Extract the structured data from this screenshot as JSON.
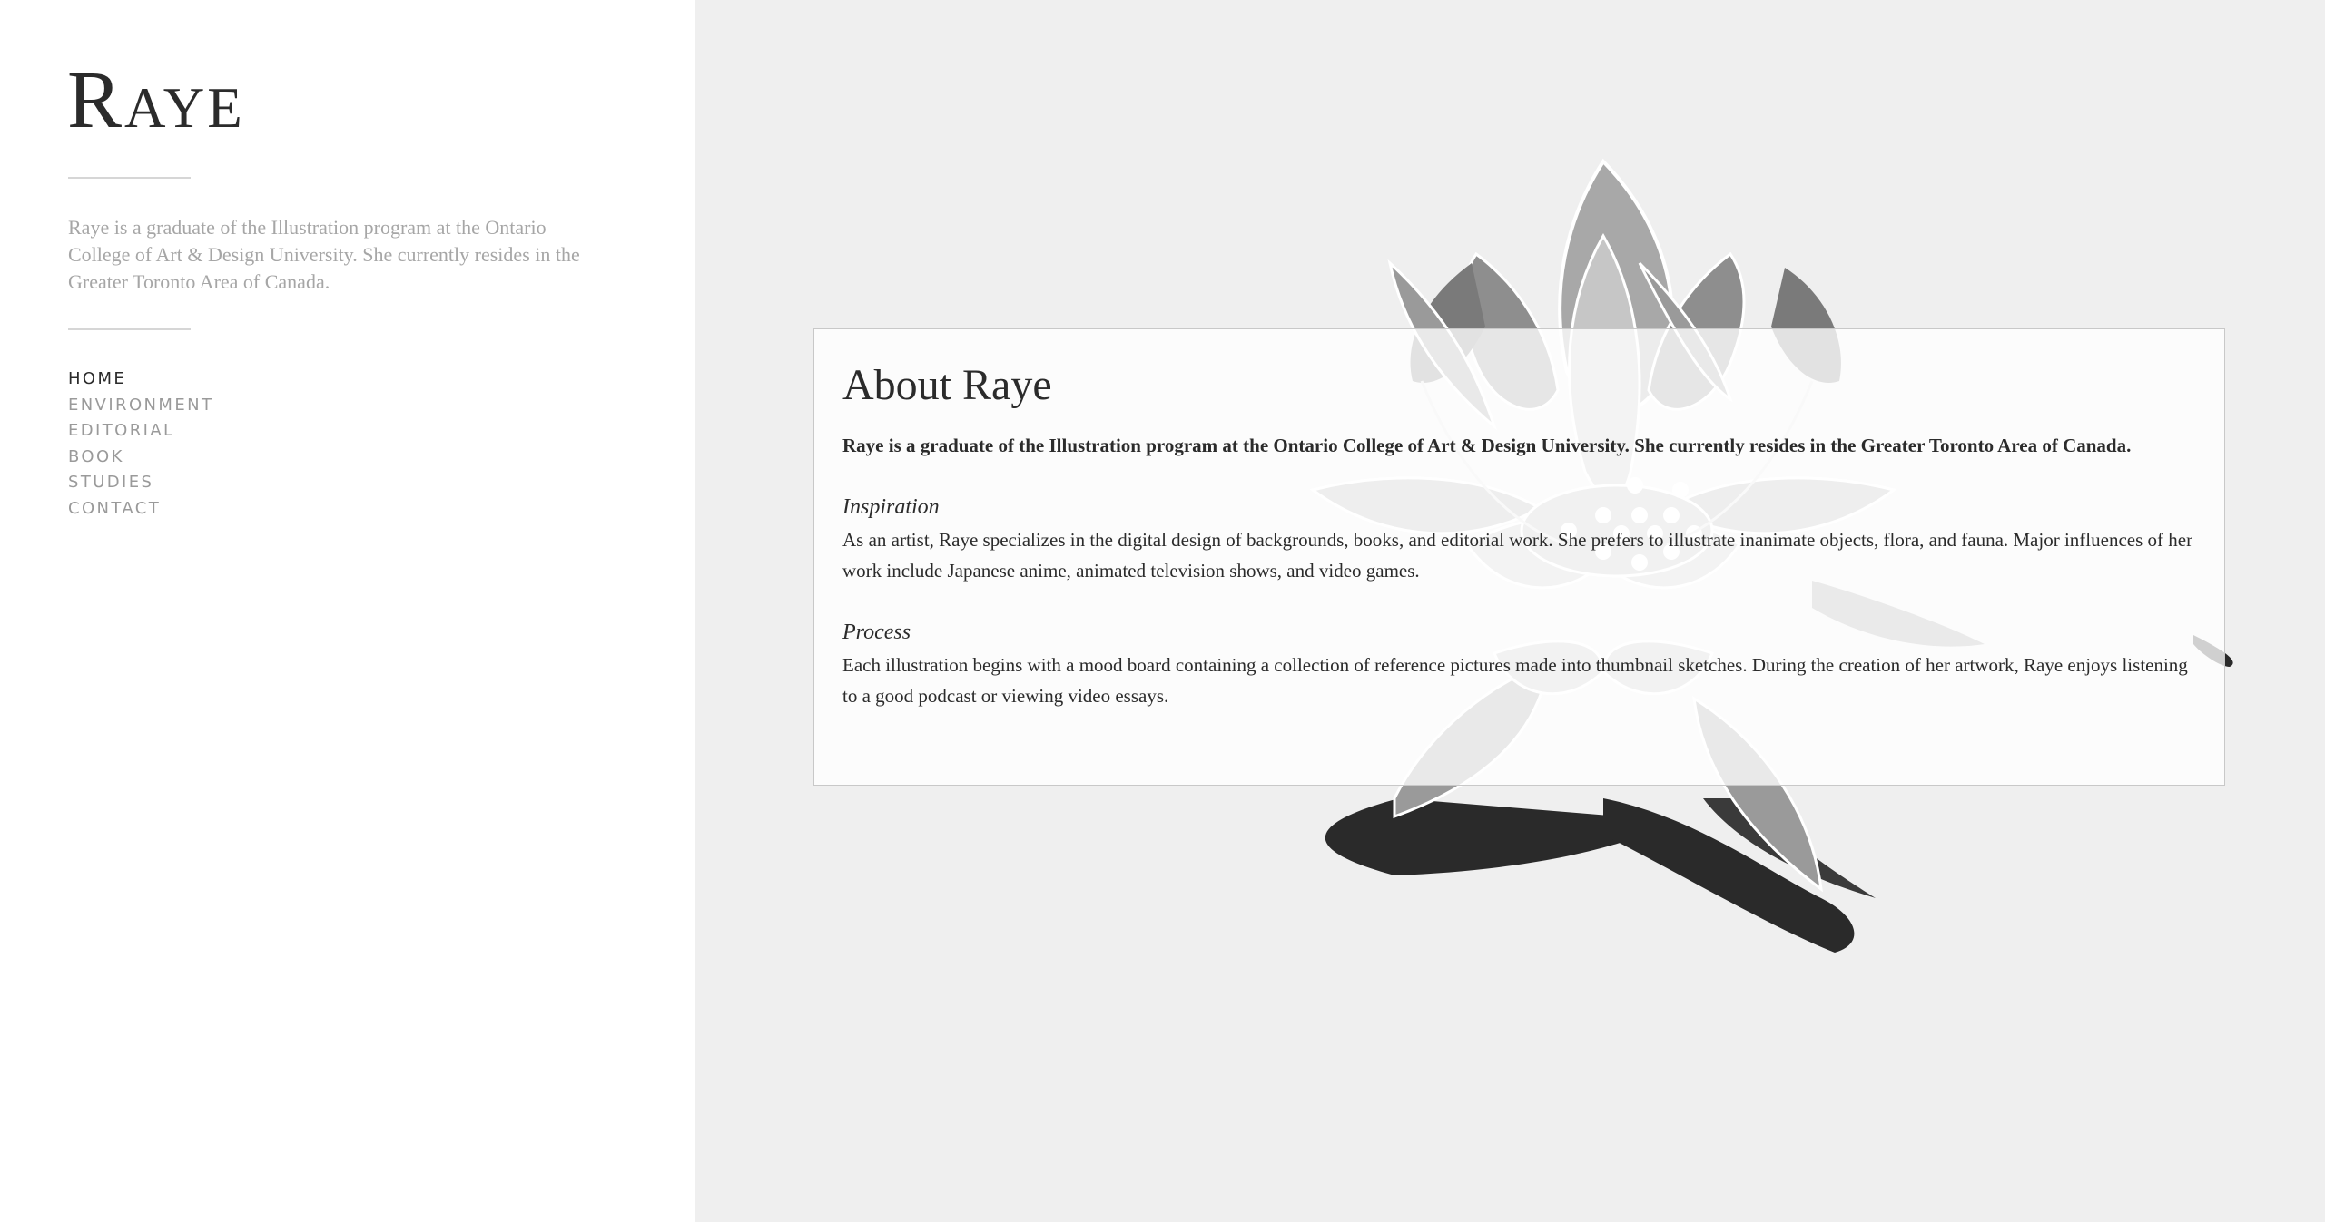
{
  "sidebar": {
    "logo": "Raye",
    "bio": "Raye is a graduate of the Illustration program at the Ontario College of Art & Design University. She currently resides in the Greater Toronto Area of Canada.",
    "nav": [
      "Home",
      "Environment",
      "Editorial",
      "Book",
      "Studies",
      "Contact"
    ],
    "active_nav": "Home"
  },
  "main": {
    "background_image": "lotus-flower-illustration",
    "title": "About Raye",
    "lead": "Raye is a graduate of the Illustration program at the Ontario College of Art & Design University. She currently resides in the Greater Toronto Area of Canada.",
    "sections": [
      {
        "heading": "Inspiration",
        "text": "As an artist, Raye specializes in the digital design of backgrounds, books, and editorial work. She prefers to illustrate inanimate objects, flora, and fauna. Major influences of her work include Japanese anime, animated television shows, and video games."
      },
      {
        "heading": "Process",
        "text": "Each illustration begins with a mood board containing a collection of reference pictures made into thumbnail sketches. During the creation of her artwork, Raye enjoys listening to a good podcast or viewing video essays."
      }
    ]
  },
  "colors": {
    "sidebar_bg": "#ffffff",
    "main_bg": "#efefef",
    "text_dark": "#2b2b2b",
    "text_muted": "#a6a6a6",
    "nav_muted": "#9a9a9a"
  }
}
